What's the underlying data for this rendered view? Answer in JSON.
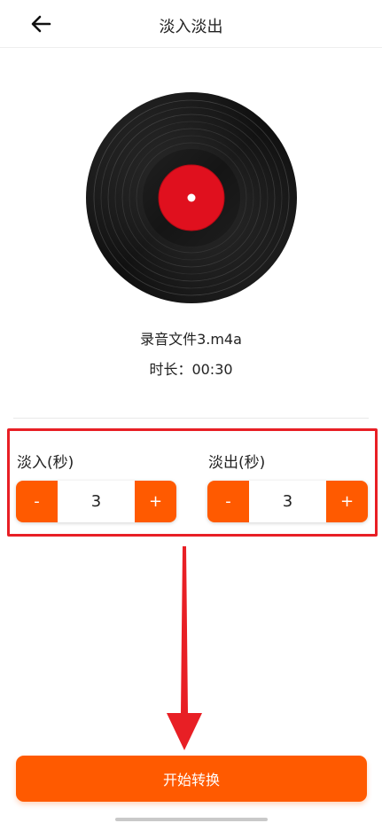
{
  "header": {
    "title": "淡入淡出",
    "back_icon": "arrow-left-icon"
  },
  "audio": {
    "file_name": "录音文件3.m4a",
    "duration_label": "时长：00:30"
  },
  "fade_in": {
    "label": "淡入(秒)",
    "minus": "-",
    "value": "3",
    "plus": "+"
  },
  "fade_out": {
    "label": "淡出(秒)",
    "minus": "-",
    "value": "3",
    "plus": "+"
  },
  "actions": {
    "convert_label": "开始转换"
  },
  "colors": {
    "accent": "#ff5a00",
    "highlight_border": "#e81f25",
    "record_label": "#e0101e"
  }
}
